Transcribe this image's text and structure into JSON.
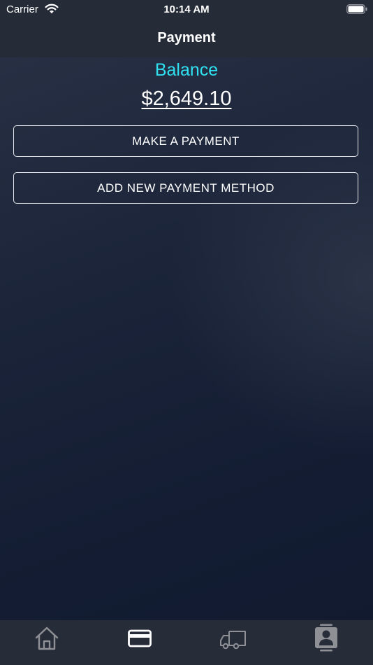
{
  "status_bar": {
    "carrier": "Carrier",
    "time": "10:14 AM",
    "wifi_icon": "wifi-icon",
    "battery_icon": "battery-icon"
  },
  "nav": {
    "title": "Payment"
  },
  "balance": {
    "label": "Balance",
    "amount": "$2,649.10",
    "label_color": "#2fe0f0"
  },
  "actions": {
    "make_payment": "MAKE A PAYMENT",
    "add_payment_method": "ADD NEW PAYMENT METHOD"
  },
  "tab_bar": {
    "items": [
      {
        "icon": "home-icon",
        "selected": false
      },
      {
        "icon": "credit-card-icon",
        "selected": true
      },
      {
        "icon": "delivery-truck-icon",
        "selected": false
      },
      {
        "icon": "contact-card-icon",
        "selected": false
      }
    ],
    "selected_color": "#ffffff",
    "unselected_color": "#8e9096"
  },
  "colors": {
    "background_top": "#2a3246",
    "background_bottom": "#111a2f",
    "bar_background": "#262b38"
  }
}
